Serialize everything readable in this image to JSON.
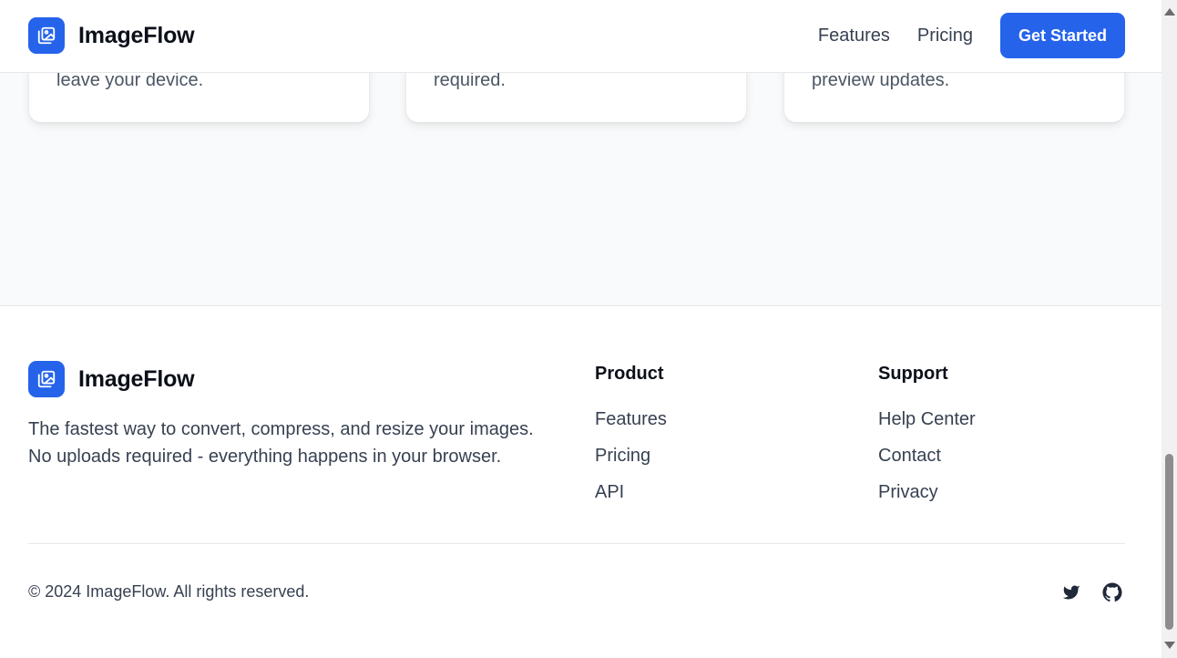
{
  "header": {
    "brand_name": "ImageFlow",
    "nav": [
      "Features",
      "Pricing"
    ],
    "cta_label": "Get Started"
  },
  "features": {
    "cards": [
      {
        "text": "leave your device."
      },
      {
        "text": "required."
      },
      {
        "text": "preview updates."
      }
    ]
  },
  "footer": {
    "brand_name": "ImageFlow",
    "description": "The fastest way to convert, compress, and resize your images. No uploads required - everything happens in your browser.",
    "product": {
      "title": "Product",
      "links": [
        "Features",
        "Pricing",
        "API"
      ]
    },
    "support": {
      "title": "Support",
      "links": [
        "Help Center",
        "Contact",
        "Privacy"
      ]
    },
    "copyright": "© 2024 ImageFlow. All rights reserved.",
    "social": [
      "twitter-icon",
      "github-icon"
    ]
  },
  "colors": {
    "accent": "#2563eb",
    "text_dark": "#0b0f19",
    "text_muted": "#374151",
    "section_bg": "#f9fafb"
  }
}
